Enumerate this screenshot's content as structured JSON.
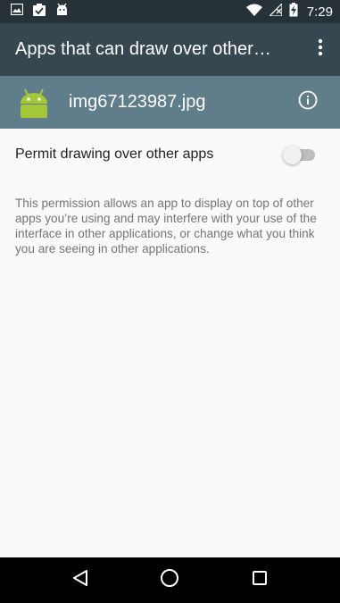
{
  "status_bar": {
    "time": "7:29",
    "left_icons": [
      "image-icon",
      "clipboard-check-icon",
      "android-icon"
    ],
    "right_icons": [
      "wifi-icon",
      "no-signal-icon",
      "battery-charging-icon"
    ]
  },
  "app_bar": {
    "title": "Apps that can draw over other…",
    "overflow_icon": "more-vert-icon"
  },
  "app_header": {
    "name": "img67123987.jpg",
    "icon": "android-icon",
    "info_icon": "info-icon"
  },
  "permission": {
    "label": "Permit drawing over other apps",
    "enabled": false,
    "description": "This permission allows an app to display on top of other apps you’re using and may interfere with your use of the interface in other applications, or change what you think you are seeing in other applications."
  },
  "colors": {
    "status_bar": "#263238",
    "app_bar": "#37474f",
    "app_header": "#607d8b",
    "android_green": "#a4c639"
  },
  "nav_bar": {
    "buttons": [
      "back-icon",
      "home-icon",
      "recents-icon"
    ]
  }
}
